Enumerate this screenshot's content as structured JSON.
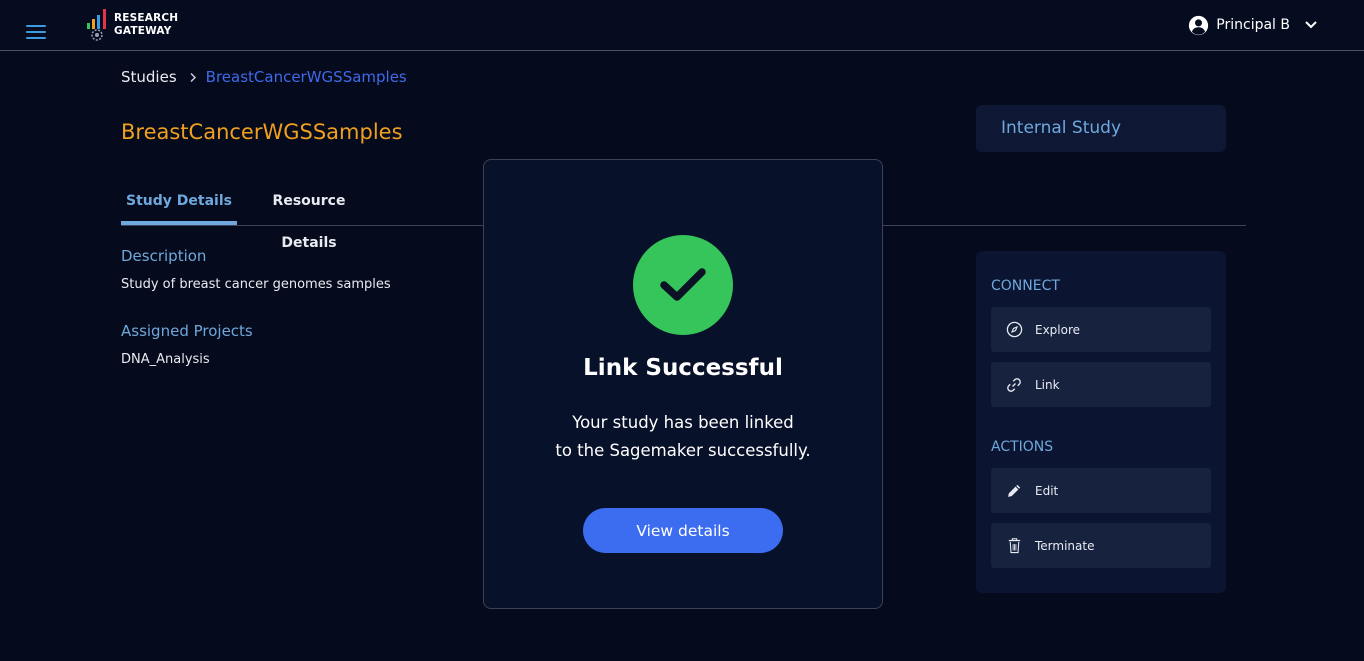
{
  "header": {
    "logo_line1": "RESEARCH",
    "logo_line2": "GATEWAY",
    "user_name": "Principal B"
  },
  "breadcrumb": {
    "root": "Studies",
    "current": "BreastCancerWGSSamples"
  },
  "page": {
    "title": "BreastCancerWGSSamples",
    "study_type": "Internal Study"
  },
  "tabs": [
    {
      "label": "Study Details",
      "active": true
    },
    {
      "label": "Resource Details",
      "active": false
    }
  ],
  "details": {
    "description_label": "Description",
    "description": "Study of breast cancer genomes samples",
    "projects_label": "Assigned Projects",
    "projects": "DNA_Analysis"
  },
  "side_panel": {
    "connect_label": "CONNECT",
    "connect_items": [
      {
        "label": "Explore",
        "icon": "compass-icon"
      },
      {
        "label": "Link",
        "icon": "link-icon"
      }
    ],
    "actions_label": "ACTIONS",
    "action_items": [
      {
        "label": "Edit",
        "icon": "pencil-icon"
      },
      {
        "label": "Terminate",
        "icon": "trash-icon"
      }
    ]
  },
  "modal": {
    "title": "Link Successful",
    "message_line1": "Your study has been linked",
    "message_line2": "to the Sagemaker successfully.",
    "button_label": "View details"
  },
  "colors": {
    "background": "#050a1c",
    "accent": "#6fa8dc",
    "title": "#f0a020",
    "link": "#3f6ae8",
    "success": "#35c55a",
    "primary_button": "#3c6cf0"
  }
}
